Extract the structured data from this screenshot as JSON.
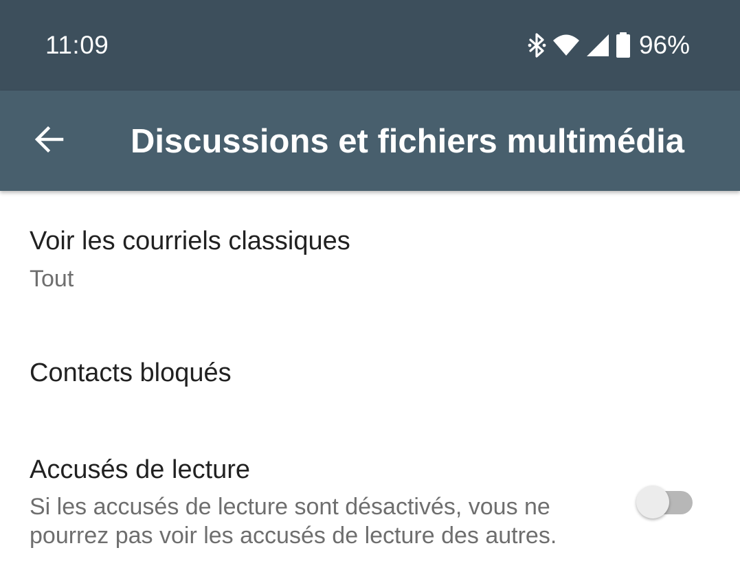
{
  "status_bar": {
    "time": "11:09",
    "battery_text": "96%",
    "icons": [
      "bluetooth-icon",
      "wifi-icon",
      "signal-icon",
      "battery-icon"
    ]
  },
  "app_bar": {
    "title": "Discussions et fichiers multimédia",
    "back_icon": "arrow-back-icon"
  },
  "settings": [
    {
      "title": "Voir les courriels classiques",
      "summary": "Tout"
    },
    {
      "title": "Contacts bloqués"
    },
    {
      "title": "Accusés de lecture",
      "summary_line1": "Si les accusés de lecture sont désactivés, vous ne",
      "summary_line2": "pourrez pas voir les accusés de lecture des autres.",
      "toggle_on": false
    }
  ],
  "colors": {
    "status_bar_bg": "#3d4f5c",
    "app_bar_bg": "#485f6d",
    "title_text": "#212121",
    "summary_text": "#6e6e6e"
  }
}
